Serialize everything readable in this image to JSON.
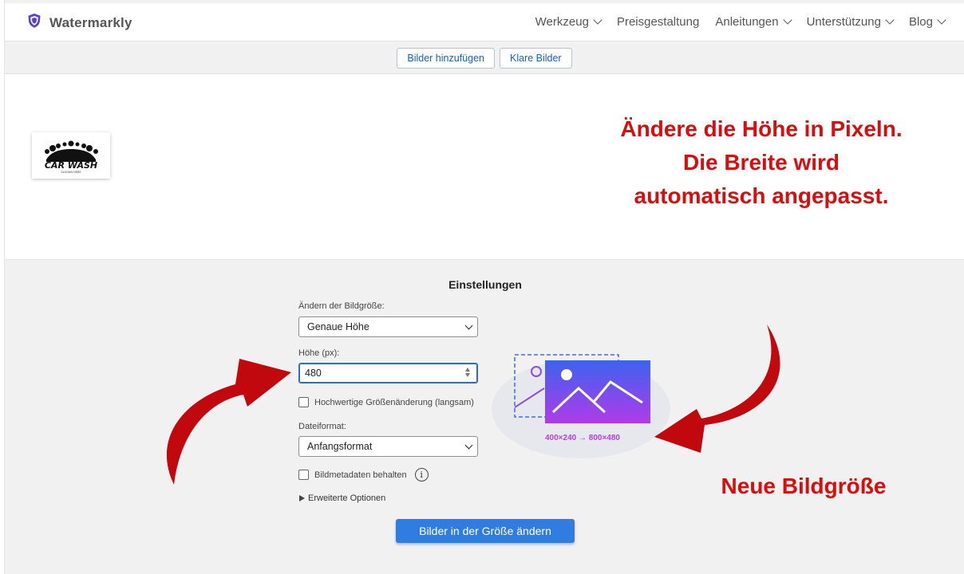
{
  "app": {
    "name": "Watermarkly"
  },
  "nav": [
    {
      "label": "Werkzeug",
      "has_dropdown": true
    },
    {
      "label": "Preisgestaltung",
      "has_dropdown": false
    },
    {
      "label": "Anleitungen",
      "has_dropdown": true
    },
    {
      "label": "Unterstützung",
      "has_dropdown": true
    },
    {
      "label": "Blog",
      "has_dropdown": true
    }
  ],
  "toolbar": {
    "add_images": "Bilder hinzufügen",
    "clear_images": "Klare Bilder"
  },
  "preview": {
    "thumbnail_logo_text": "CAR WASH",
    "thumbnail_logo_subtext": "SLOGAN HERE"
  },
  "annotation_top": {
    "line1": "Ändere die Höhe in Pixeln.",
    "line2": "Die Breite wird",
    "line3": "automatisch angepasst."
  },
  "annotation_bottom": "Neue Bildgröße",
  "settings": {
    "title": "Einstellungen",
    "resize_label": "Ändern der Bildgröße:",
    "resize_value": "Genaue Höhe",
    "height_label": "Höhe (px):",
    "height_value": "480",
    "hq_resize_label": "Hochwertige Größenänderung (langsam)",
    "hq_resize_checked": false,
    "format_label": "Dateiformat:",
    "format_value": "Anfangsformat",
    "keep_metadata_label": "Bildmetadaten behalten",
    "keep_metadata_checked": false,
    "advanced_label": "Erweiterte Optionen",
    "submit_label": "Bilder in der Größe ändern"
  },
  "illustration": {
    "caption": "400×240 → 800×480"
  },
  "colors": {
    "accent": "#2f7de1",
    "annotation": "#d80d0d",
    "arrow": "#c1080d",
    "illustration_purple": "#b43ee6"
  }
}
